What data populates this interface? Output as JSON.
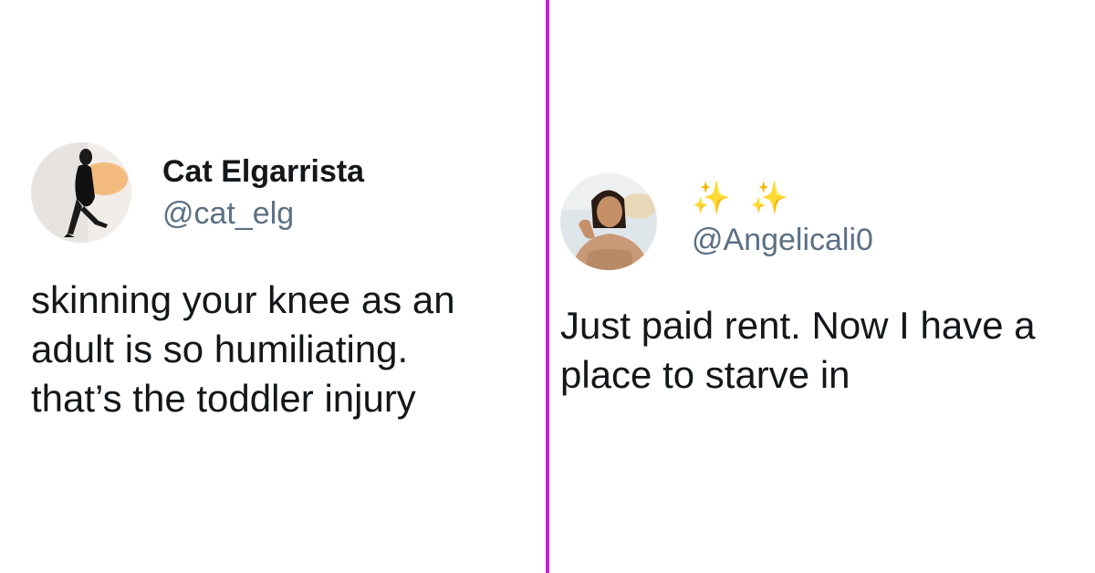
{
  "tweets": [
    {
      "display_name": "Cat Elgarrista",
      "handle": "@cat_elg",
      "text": "skinning your knee as an\nadult is so humiliating.\nthat’s the toddler injury"
    },
    {
      "display_name": "✨ ✨",
      "handle": "@Angelicali0",
      "text": "Just paid rent. Now I have a\nplace to starve in"
    }
  ],
  "colors": {
    "divider": "#c81ed8",
    "handle": "#5b7083",
    "text": "#14171a"
  }
}
